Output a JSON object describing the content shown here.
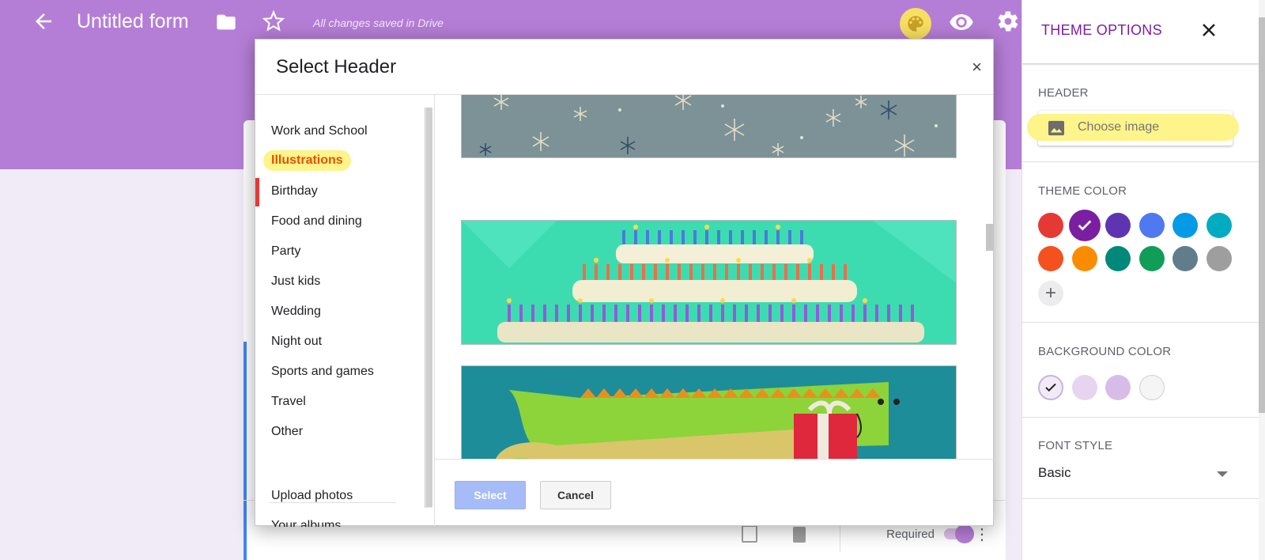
{
  "topbar": {
    "title": "Untitled form",
    "saved_status": "All changes saved in Drive",
    "icons": [
      "back-arrow-icon",
      "folder-icon",
      "star-icon",
      "palette-icon",
      "eye-icon",
      "gear-icon"
    ]
  },
  "form_footer": {
    "required_label": "Required"
  },
  "dialog": {
    "title": "Select Header",
    "close": "×",
    "categories": [
      {
        "label": "Work and School",
        "active": false
      },
      {
        "label": "Illustrations",
        "active": true
      },
      {
        "label": "Birthday",
        "active": false
      },
      {
        "label": "Food and dining",
        "active": false
      },
      {
        "label": "Party",
        "active": false
      },
      {
        "label": "Just kids",
        "active": false
      },
      {
        "label": "Wedding",
        "active": false
      },
      {
        "label": "Night out",
        "active": false
      },
      {
        "label": "Sports and games",
        "active": false
      },
      {
        "label": "Travel",
        "active": false
      },
      {
        "label": "Other",
        "active": false
      }
    ],
    "extra_items": [
      "Upload photos",
      "Your albums"
    ],
    "images": [
      "snowflakes-header",
      "birthday-cake-header",
      "crocodile-gift-header"
    ],
    "select_label": "Select",
    "cancel_label": "Cancel"
  },
  "panel": {
    "title": "THEME OPTIONS",
    "header_label": "HEADER",
    "choose_image": "Choose image",
    "theme_color_label": "THEME COLOR",
    "theme_colors": [
      "#e53935",
      "#7b1fa2",
      "#5e35b1",
      "#4e79f0",
      "#039be5",
      "#00acc1",
      "#f4511e",
      "#fb8c00",
      "#00897b",
      "#0f9d58",
      "#607d8b",
      "#9e9e9e"
    ],
    "selected_theme_color": "#7b1fa2",
    "background_color_label": "BACKGROUND COLOR",
    "background_colors": [
      "#f1ebf8",
      "#e6d4f1",
      "#d8bce8",
      "#f5f5f5"
    ],
    "selected_background_color": "#f1ebf8",
    "font_style_label": "FONT STYLE",
    "font_style_value": "Basic"
  }
}
